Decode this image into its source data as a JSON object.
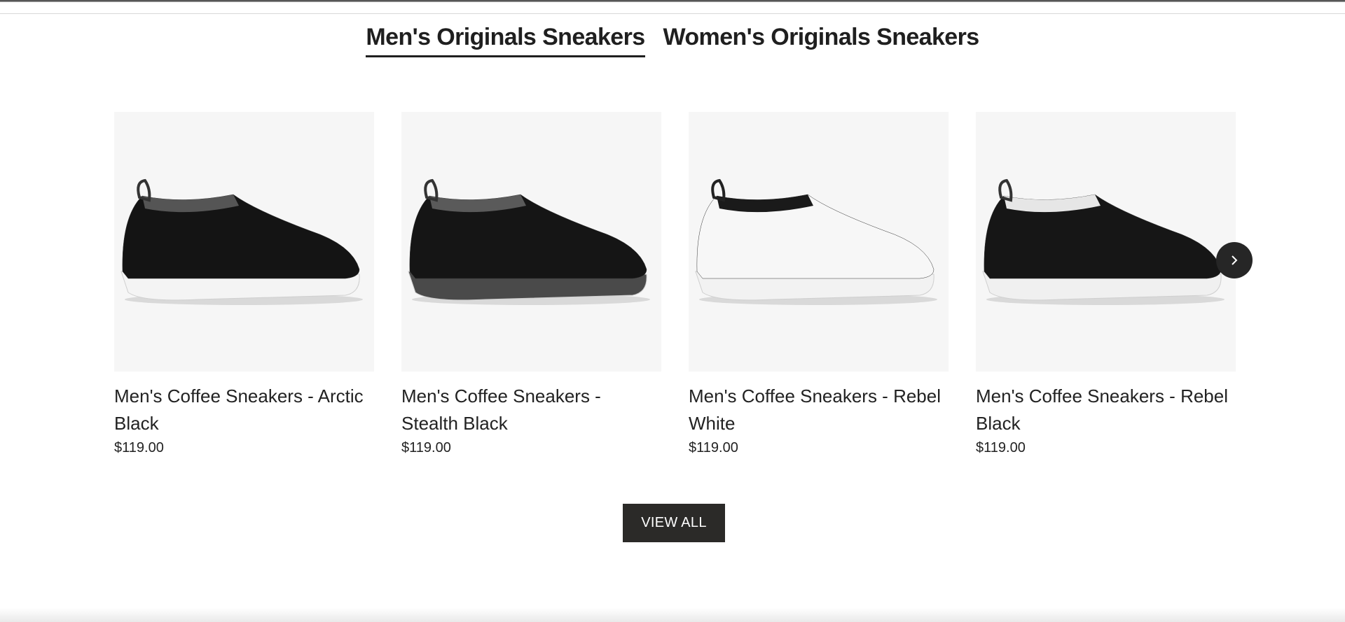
{
  "tabs": [
    {
      "label": "Men's Originals Sneakers",
      "active": true
    },
    {
      "label": "Women's Originals Sneakers",
      "active": false
    }
  ],
  "products": [
    {
      "title": "Men's Coffee Sneakers - Arctic Black",
      "price": "$119.00",
      "colors": {
        "upper": "#141414",
        "collar": "#555555",
        "sole": "#f4f4f4"
      }
    },
    {
      "title": "Men's Coffee Sneakers - Stealth Black",
      "price": "$119.00",
      "colors": {
        "upper": "#151515",
        "collar": "#5a5a5a",
        "sole": "#4a4a4a"
      }
    },
    {
      "title": "Men's Coffee Sneakers - Rebel White",
      "price": "$119.00",
      "colors": {
        "upper": "#f7f7f7",
        "collar": "#1a1a1a",
        "sole": "#f2f2f2"
      }
    },
    {
      "title": "Men's Coffee Sneakers - Rebel Black",
      "price": "$119.00",
      "colors": {
        "upper": "#161616",
        "collar": "#e6e6e6",
        "sole": "#f0f0f0"
      }
    }
  ],
  "carousel": {
    "next_icon": "chevron-right-icon"
  },
  "view_all_label": "VIEW ALL",
  "colors": {
    "button_bg": "#2b2a28",
    "image_bg": "#f6f6f6",
    "text": "#222222"
  }
}
